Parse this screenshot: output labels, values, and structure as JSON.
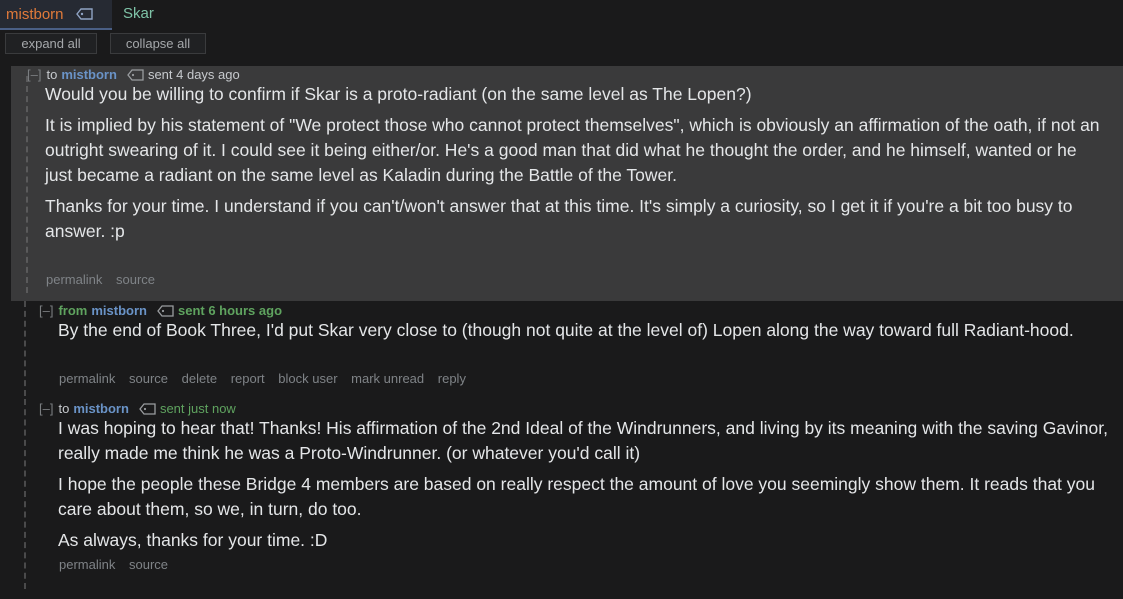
{
  "topbar": {
    "user": "mistborn",
    "subject": "Skar"
  },
  "buttons": {
    "expand": "expand all",
    "collapse": "collapse all"
  },
  "messages": [
    {
      "toggle": "[–]",
      "direction": "to",
      "author": "mistborn",
      "time": "sent 4 days ago",
      "paragraphs": [
        "Would you be willing to confirm if Skar is a proto-radiant (on the same level as The Lopen?)",
        "It is implied by his statement of \"We protect those who cannot protect themselves\", which is obviously an affirmation of the oath, if not an outright swearing of it. I could see it being either/or. He's a good man that did what he thought the order, and he himself, wanted or he just became a radiant on the same level as Kaladin during the Battle of the Tower.",
        "Thanks for your time. I understand if you can't/won't answer that at this time. It's simply a curiosity, so I get it if you're a bit too busy to answer. :p"
      ],
      "links": [
        "permalink",
        "source"
      ]
    },
    {
      "toggle": "[–]",
      "direction": "from",
      "author": "mistborn",
      "time": "sent 6 hours ago",
      "paragraphs": [
        "By the end of Book Three, I'd put Skar very close to (though not quite at the level of) Lopen along the way toward full Radiant-hood."
      ],
      "links": [
        "permalink",
        "source",
        "delete",
        "report",
        "block user",
        "mark unread",
        "reply"
      ]
    },
    {
      "toggle": "[–]",
      "direction": "to",
      "author": "mistborn",
      "time": "sent just now",
      "paragraphs": [
        "I was hoping to hear that! Thanks! His affirmation of the 2nd Ideal of the Windrunners, and living by its meaning with the saving Gavinor, really made me think he was a Proto-Windrunner. (or whatever you'd call it)",
        "I hope the people these Bridge 4 members are based on really respect the amount of love you seemingly show them. It reads that you care about them, so we, in turn, do too.",
        "As always, thanks for your time. :D"
      ],
      "links": [
        "permalink",
        "source"
      ]
    }
  ],
  "colors": {
    "background": "#1a1a1b",
    "user": "#e07a3a",
    "subject": "#7fc4a8",
    "author": "#6a93c7",
    "sent_green": "#5fa35f"
  }
}
